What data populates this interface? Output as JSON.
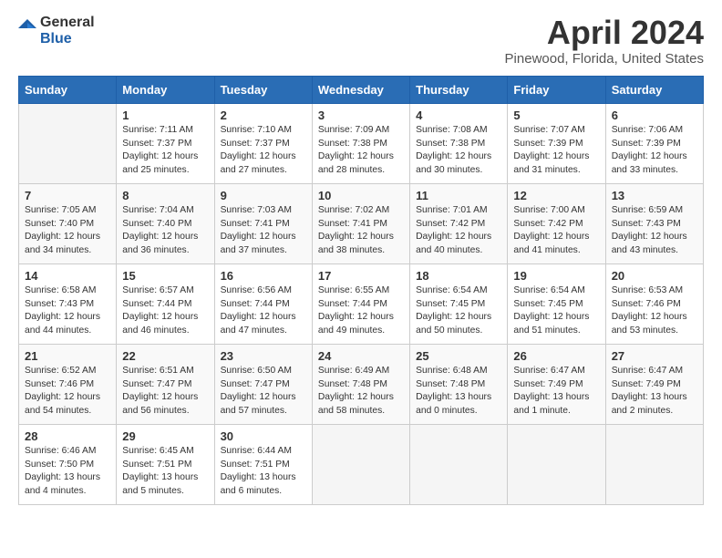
{
  "header": {
    "logo_general": "General",
    "logo_blue": "Blue",
    "month": "April 2024",
    "location": "Pinewood, Florida, United States"
  },
  "days_of_week": [
    "Sunday",
    "Monday",
    "Tuesday",
    "Wednesday",
    "Thursday",
    "Friday",
    "Saturday"
  ],
  "weeks": [
    [
      {
        "day": "",
        "empty": true
      },
      {
        "day": "1",
        "sunrise": "7:11 AM",
        "sunset": "7:37 PM",
        "daylight": "12 hours and 25 minutes."
      },
      {
        "day": "2",
        "sunrise": "7:10 AM",
        "sunset": "7:37 PM",
        "daylight": "12 hours and 27 minutes."
      },
      {
        "day": "3",
        "sunrise": "7:09 AM",
        "sunset": "7:38 PM",
        "daylight": "12 hours and 28 minutes."
      },
      {
        "day": "4",
        "sunrise": "7:08 AM",
        "sunset": "7:38 PM",
        "daylight": "12 hours and 30 minutes."
      },
      {
        "day": "5",
        "sunrise": "7:07 AM",
        "sunset": "7:39 PM",
        "daylight": "12 hours and 31 minutes."
      },
      {
        "day": "6",
        "sunrise": "7:06 AM",
        "sunset": "7:39 PM",
        "daylight": "12 hours and 33 minutes."
      }
    ],
    [
      {
        "day": "7",
        "sunrise": "7:05 AM",
        "sunset": "7:40 PM",
        "daylight": "12 hours and 34 minutes."
      },
      {
        "day": "8",
        "sunrise": "7:04 AM",
        "sunset": "7:40 PM",
        "daylight": "12 hours and 36 minutes."
      },
      {
        "day": "9",
        "sunrise": "7:03 AM",
        "sunset": "7:41 PM",
        "daylight": "12 hours and 37 minutes."
      },
      {
        "day": "10",
        "sunrise": "7:02 AM",
        "sunset": "7:41 PM",
        "daylight": "12 hours and 38 minutes."
      },
      {
        "day": "11",
        "sunrise": "7:01 AM",
        "sunset": "7:42 PM",
        "daylight": "12 hours and 40 minutes."
      },
      {
        "day": "12",
        "sunrise": "7:00 AM",
        "sunset": "7:42 PM",
        "daylight": "12 hours and 41 minutes."
      },
      {
        "day": "13",
        "sunrise": "6:59 AM",
        "sunset": "7:43 PM",
        "daylight": "12 hours and 43 minutes."
      }
    ],
    [
      {
        "day": "14",
        "sunrise": "6:58 AM",
        "sunset": "7:43 PM",
        "daylight": "12 hours and 44 minutes."
      },
      {
        "day": "15",
        "sunrise": "6:57 AM",
        "sunset": "7:44 PM",
        "daylight": "12 hours and 46 minutes."
      },
      {
        "day": "16",
        "sunrise": "6:56 AM",
        "sunset": "7:44 PM",
        "daylight": "12 hours and 47 minutes."
      },
      {
        "day": "17",
        "sunrise": "6:55 AM",
        "sunset": "7:44 PM",
        "daylight": "12 hours and 49 minutes."
      },
      {
        "day": "18",
        "sunrise": "6:54 AM",
        "sunset": "7:45 PM",
        "daylight": "12 hours and 50 minutes."
      },
      {
        "day": "19",
        "sunrise": "6:54 AM",
        "sunset": "7:45 PM",
        "daylight": "12 hours and 51 minutes."
      },
      {
        "day": "20",
        "sunrise": "6:53 AM",
        "sunset": "7:46 PM",
        "daylight": "12 hours and 53 minutes."
      }
    ],
    [
      {
        "day": "21",
        "sunrise": "6:52 AM",
        "sunset": "7:46 PM",
        "daylight": "12 hours and 54 minutes."
      },
      {
        "day": "22",
        "sunrise": "6:51 AM",
        "sunset": "7:47 PM",
        "daylight": "12 hours and 56 minutes."
      },
      {
        "day": "23",
        "sunrise": "6:50 AM",
        "sunset": "7:47 PM",
        "daylight": "12 hours and 57 minutes."
      },
      {
        "day": "24",
        "sunrise": "6:49 AM",
        "sunset": "7:48 PM",
        "daylight": "12 hours and 58 minutes."
      },
      {
        "day": "25",
        "sunrise": "6:48 AM",
        "sunset": "7:48 PM",
        "daylight": "13 hours and 0 minutes."
      },
      {
        "day": "26",
        "sunrise": "6:47 AM",
        "sunset": "7:49 PM",
        "daylight": "13 hours and 1 minute."
      },
      {
        "day": "27",
        "sunrise": "6:47 AM",
        "sunset": "7:49 PM",
        "daylight": "13 hours and 2 minutes."
      }
    ],
    [
      {
        "day": "28",
        "sunrise": "6:46 AM",
        "sunset": "7:50 PM",
        "daylight": "13 hours and 4 minutes."
      },
      {
        "day": "29",
        "sunrise": "6:45 AM",
        "sunset": "7:51 PM",
        "daylight": "13 hours and 5 minutes."
      },
      {
        "day": "30",
        "sunrise": "6:44 AM",
        "sunset": "7:51 PM",
        "daylight": "13 hours and 6 minutes."
      },
      {
        "day": "",
        "empty": true
      },
      {
        "day": "",
        "empty": true
      },
      {
        "day": "",
        "empty": true
      },
      {
        "day": "",
        "empty": true
      }
    ]
  ]
}
